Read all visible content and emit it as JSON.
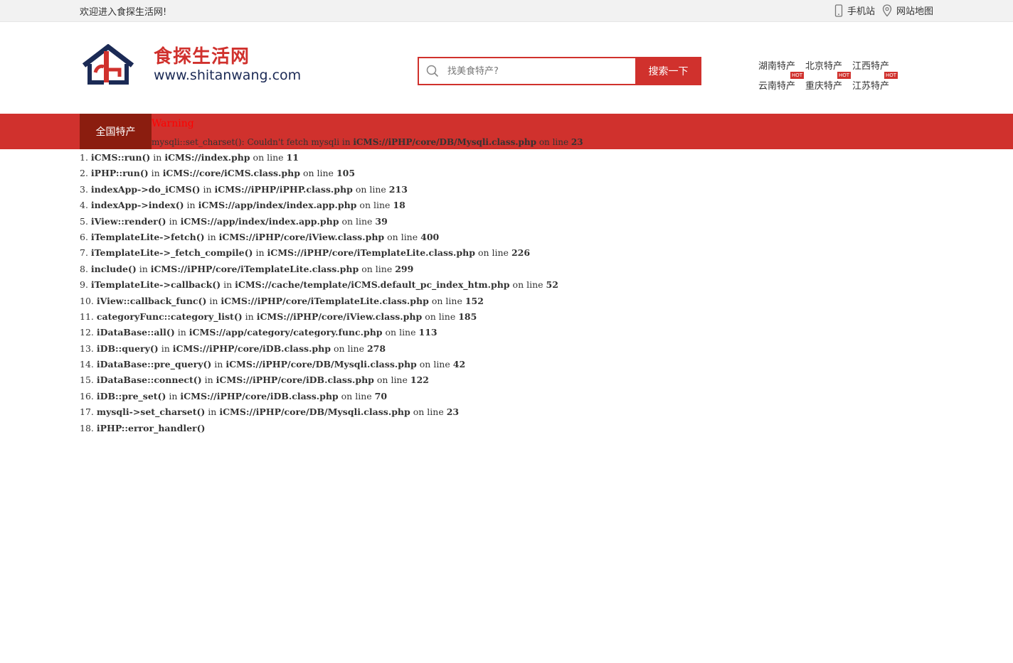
{
  "topbar": {
    "welcome": "欢迎进入食探生活网!",
    "mobile_label": "手机站",
    "sitemap_label": "网站地图"
  },
  "logo": {
    "name": "食探生活网",
    "url": "www.shitanwang.com",
    "colors": {
      "red": "#d0312d",
      "navy": "#1b2a55"
    }
  },
  "search": {
    "placeholder": "找美食特产?",
    "button": "搜索一下"
  },
  "hotlinks": {
    "row1": [
      "湖南特产",
      "北京特产",
      "江西特产"
    ],
    "row2": [
      "云南特产",
      "重庆特产",
      "江苏特产"
    ],
    "hot_badge": "HOT"
  },
  "nav": {
    "all_label": "全国特产",
    "accent": "#d0312d",
    "active_bg": "#8b1d0f"
  },
  "warning": {
    "title": "Warning",
    "msg_prefix": "mysqli::set_charset(): Couldn't fetch mysqli in ",
    "msg_file": "iCMS://iPHP/core/DB/Mysqli.class.php",
    "msg_mid": " on line ",
    "msg_line": "23"
  },
  "trace": [
    {
      "num": "1.",
      "func": "iCMS::run()",
      "file": "iCMS://index.php",
      "line": "11"
    },
    {
      "num": "2.",
      "func": "iPHP::run()",
      "file": "iCMS://core/iCMS.class.php",
      "line": "105"
    },
    {
      "num": "3.",
      "func": "indexApp->do_iCMS()",
      "file": "iCMS://iPHP/iPHP.class.php",
      "line": "213"
    },
    {
      "num": "4.",
      "func": "indexApp->index()",
      "file": "iCMS://app/index/index.app.php",
      "line": "18"
    },
    {
      "num": "5.",
      "func": "iView::render()",
      "file": "iCMS://app/index/index.app.php",
      "line": "39"
    },
    {
      "num": "6.",
      "func": "iTemplateLite->fetch()",
      "file": "iCMS://iPHP/core/iView.class.php",
      "line": "400"
    },
    {
      "num": "7.",
      "func": "iTemplateLite->_fetch_compile()",
      "file": "iCMS://iPHP/core/iTemplateLite.class.php",
      "line": "226"
    },
    {
      "num": "8.",
      "func": "include()",
      "file": "iCMS://iPHP/core/iTemplateLite.class.php",
      "line": "299"
    },
    {
      "num": "9.",
      "func": "iTemplateLite->callback()",
      "file": "iCMS://cache/template/iCMS.default_pc_index_htm.php",
      "line": "52"
    },
    {
      "num": "10.",
      "func": "iView::callback_func()",
      "file": "iCMS://iPHP/core/iTemplateLite.class.php",
      "line": "152"
    },
    {
      "num": "11.",
      "func": "categoryFunc::category_list()",
      "file": "iCMS://iPHP/core/iView.class.php",
      "line": "185"
    },
    {
      "num": "12.",
      "func": "iDataBase::all()",
      "file": "iCMS://app/category/category.func.php",
      "line": "113"
    },
    {
      "num": "13.",
      "func": "iDB::query()",
      "file": "iCMS://iPHP/core/iDB.class.php",
      "line": "278"
    },
    {
      "num": "14.",
      "func": "iDataBase::pre_query()",
      "file": "iCMS://iPHP/core/DB/Mysqli.class.php",
      "line": "42"
    },
    {
      "num": "15.",
      "func": "iDataBase::connect()",
      "file": "iCMS://iPHP/core/iDB.class.php",
      "line": "122"
    },
    {
      "num": "16.",
      "func": "iDB::pre_set()",
      "file": "iCMS://iPHP/core/iDB.class.php",
      "line": "70"
    },
    {
      "num": "17.",
      "func": "mysqli->set_charset()",
      "file": "iCMS://iPHP/core/DB/Mysqli.class.php",
      "line": "23"
    },
    {
      "num": "18.",
      "func": "iPHP::error_handler()",
      "file": "",
      "line": ""
    }
  ],
  "trace_words": {
    "in": "in",
    "on_line": "on line"
  }
}
